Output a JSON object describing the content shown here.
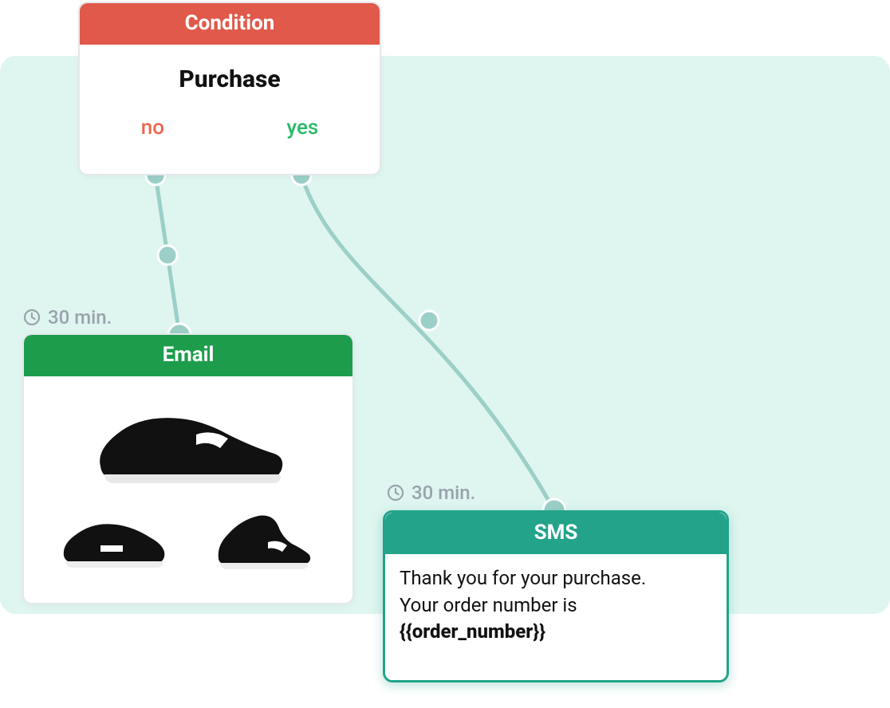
{
  "condition": {
    "header": "Condition",
    "title": "Purchase",
    "no_label": "no",
    "yes_label": "yes"
  },
  "email": {
    "header": "Email",
    "delay": "30 min."
  },
  "sms": {
    "header": "SMS",
    "delay": "30 min.",
    "body_line1": "Thank you for your purchase.",
    "body_line2": "Your order number is",
    "body_var": "{{order_number}}"
  },
  "colors": {
    "condition_header": "#e0594a",
    "email_header": "#1d9d4c",
    "sms_header": "#22a38a",
    "canvas_bg": "#dff5f0",
    "connector": "#9bcfc7",
    "no_text": "#e9674f",
    "yes_text": "#2aba67"
  }
}
